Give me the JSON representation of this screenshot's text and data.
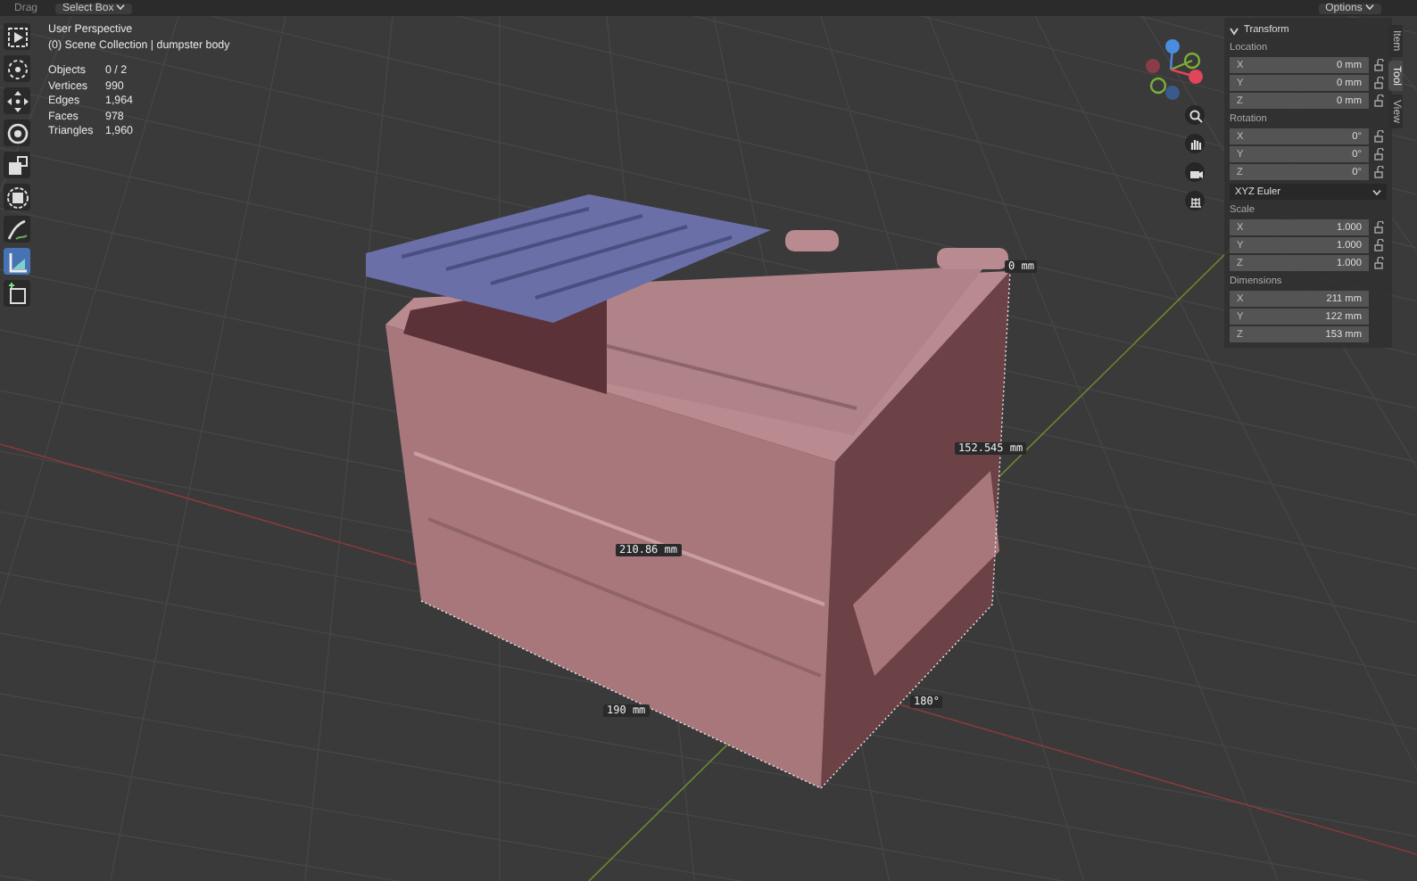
{
  "header": {
    "drag_label": "Drag",
    "select_mode": "Select Box",
    "options": "Options"
  },
  "toolbar": [
    {
      "selected": false
    },
    {
      "selected": false
    },
    {
      "selected": false
    },
    {
      "selected": false
    },
    {
      "selected": false
    },
    {
      "selected": false
    },
    {
      "selected": false
    },
    {
      "selected": true
    },
    {
      "selected": false
    }
  ],
  "overlay": {
    "view_name": "User Perspective",
    "collection": "(0) Scene Collection | dumpster body",
    "stats": [
      {
        "label": "Objects",
        "value": "0 / 2"
      },
      {
        "label": "Vertices",
        "value": "990"
      },
      {
        "label": "Edges",
        "value": "1,964"
      },
      {
        "label": "Faces",
        "value": "978"
      },
      {
        "label": "Triangles",
        "value": "1,960"
      }
    ]
  },
  "measurements": [
    "0 mm",
    "152.545 mm",
    "210.86 mm",
    "190 mm",
    "180°"
  ],
  "panel": {
    "section": "Transform",
    "expanded": true,
    "groups": [
      {
        "title": "Location",
        "locks": true,
        "rows": [
          {
            "axis": "X",
            "value": "0 mm"
          },
          {
            "axis": "Y",
            "value": "0 mm"
          },
          {
            "axis": "Z",
            "value": "0 mm"
          }
        ]
      },
      {
        "title": "Rotation",
        "locks": true,
        "rows": [
          {
            "axis": "X",
            "value": "0°"
          },
          {
            "axis": "Y",
            "value": "0°"
          },
          {
            "axis": "Z",
            "value": "0°"
          }
        ],
        "mode": "XYZ Euler"
      },
      {
        "title": "Scale",
        "locks": true,
        "rows": [
          {
            "axis": "X",
            "value": "1.000"
          },
          {
            "axis": "Y",
            "value": "1.000"
          },
          {
            "axis": "Z",
            "value": "1.000"
          }
        ]
      },
      {
        "title": "Dimensions",
        "locks": false,
        "rows": [
          {
            "axis": "X",
            "value": "211 mm"
          },
          {
            "axis": "Y",
            "value": "122 mm"
          },
          {
            "axis": "Z",
            "value": "153 mm"
          }
        ]
      }
    ]
  },
  "tabs": [
    {
      "label": "Item",
      "selected": false
    },
    {
      "label": "Tool",
      "selected": true
    },
    {
      "label": "View",
      "selected": false
    }
  ]
}
